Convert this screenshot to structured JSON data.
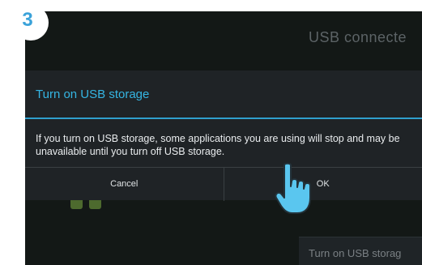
{
  "step": {
    "number": "3"
  },
  "background": {
    "title": "USB connecte",
    "subtitle": "",
    "bottom_button_label": "Turn on USB storag"
  },
  "dialog": {
    "title": "Turn on USB storage",
    "message": "If you turn on USB storage, some applications you are using will stop and may be unavailable until you turn off USB storage.",
    "buttons": {
      "cancel": "Cancel",
      "ok": "OK"
    }
  },
  "icons": {
    "step_badge": "step-number-badge",
    "pointer": "hand-pointer-icon",
    "usb": "usb-connector-icon"
  },
  "colors": {
    "accent": "#35b5e3",
    "badge": "#3aa2d9",
    "dialog_bg": "#1f2326",
    "screen_bg": "#131816",
    "pointer_fill": "#5ac6ef"
  }
}
